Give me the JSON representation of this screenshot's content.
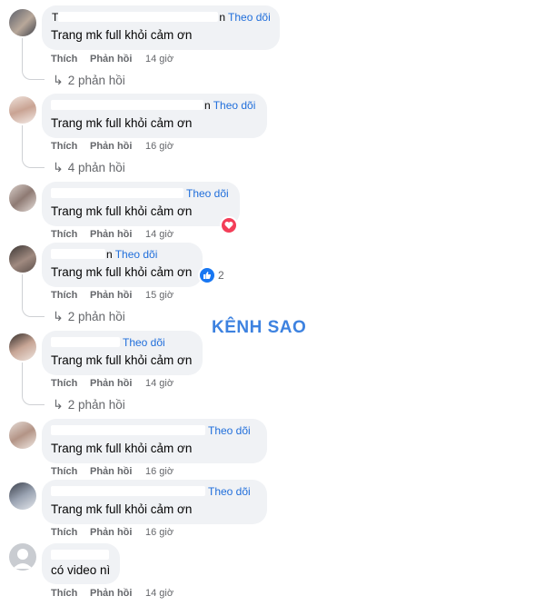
{
  "labels": {
    "follow": "Theo dõi",
    "like": "Thích",
    "reply": "Phản hồi"
  },
  "watermark": "KÊNH SAO",
  "comments": [
    {
      "name_fragment_start": "T",
      "name_fragment_end": "n",
      "text": "Trang mk full khỏi cảm ơn",
      "time": "14 giờ",
      "replies": "2 phản hồi"
    },
    {
      "name_fragment_start": "",
      "name_fragment_end": "n",
      "text": "Trang mk full khỏi cảm ơn",
      "time": "16 giờ",
      "replies": "4 phản hồi"
    },
    {
      "name_fragment_start": "",
      "name_fragment_end": "",
      "text": "Trang mk full khỏi cảm ơn",
      "time": "14 giờ",
      "reaction": "heart"
    },
    {
      "name_fragment_start": "",
      "name_fragment_end": "n",
      "text": "Trang mk full khỏi cảm ơn",
      "time": "15 giờ",
      "replies": "2 phản hồi",
      "reaction": "like",
      "reaction_count": "2"
    },
    {
      "name_fragment_start": "",
      "name_fragment_end": "",
      "text": "Trang mk full khỏi cảm ơn",
      "time": "14 giờ",
      "replies": "2 phản hồi"
    },
    {
      "name_fragment_start": "",
      "name_fragment_end": "",
      "text": "Trang mk full khỏi cảm ơn",
      "time": "16 giờ"
    },
    {
      "name_fragment_start": "",
      "name_fragment_end": "",
      "text": "Trang mk full khỏi cảm ơn",
      "time": "16 giờ"
    },
    {
      "name_fragment_start": "",
      "name_fragment_end": "",
      "text": "có video nì",
      "time": "14 giờ"
    }
  ],
  "colors": {
    "bubble": "#f0f2f5",
    "follow": "#216fdb",
    "meta": "#65676b",
    "watermark": "#3d82e0",
    "heart": "#f33e58",
    "like": "#1877f2"
  }
}
